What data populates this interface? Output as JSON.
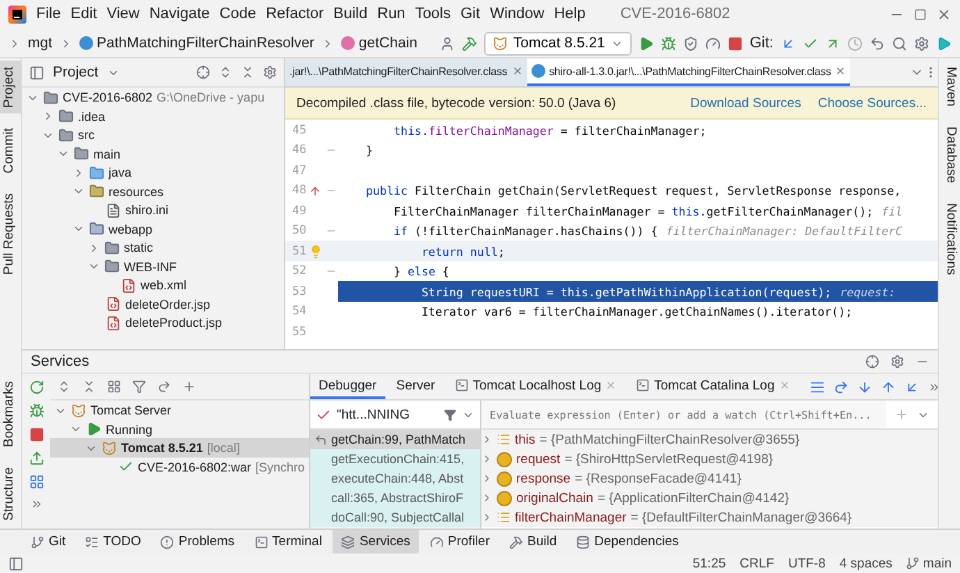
{
  "window": {
    "title": "CVE-2016-6802"
  },
  "menu": [
    "File",
    "Edit",
    "View",
    "Navigate",
    "Code",
    "Refactor",
    "Build",
    "Run",
    "Tools",
    "Git",
    "Window",
    "Help"
  ],
  "breadcrumbs": [
    {
      "label": "mgt",
      "kind": "package"
    },
    {
      "label": "PathMatchingFilterChainResolver",
      "kind": "class"
    },
    {
      "label": "getChain",
      "kind": "method"
    }
  ],
  "toolbar": {
    "run_config": "Tomcat 8.5.21",
    "git_label": "Git:"
  },
  "side_tabs": {
    "left_top": [
      {
        "label": "Project",
        "selected": true
      },
      {
        "label": "Commit",
        "selected": false
      },
      {
        "label": "Pull Requests",
        "selected": false
      }
    ],
    "left_bottom": [
      {
        "label": "Bookmarks",
        "selected": false
      },
      {
        "label": "Structure",
        "selected": false
      }
    ],
    "right": [
      {
        "label": "Maven",
        "selected": false
      },
      {
        "label": "Database",
        "selected": false
      },
      {
        "label": "Notifications",
        "selected": false
      }
    ]
  },
  "project": {
    "title": "Project",
    "tree": [
      {
        "label": "CVE-2016-6802",
        "note": "G:\\OneDrive - yapu",
        "kind": "module",
        "expanded": true,
        "children": [
          {
            "label": ".idea",
            "kind": "folder",
            "expanded": false
          },
          {
            "label": "src",
            "kind": "folder",
            "expanded": true,
            "children": [
              {
                "label": "main",
                "kind": "folder",
                "expanded": true,
                "children": [
                  {
                    "label": "java",
                    "kind": "source",
                    "expanded": false
                  },
                  {
                    "label": "resources",
                    "kind": "resources",
                    "expanded": true,
                    "children": [
                      {
                        "label": "shiro.ini",
                        "kind": "file"
                      }
                    ]
                  },
                  {
                    "label": "webapp",
                    "kind": "web",
                    "expanded": true,
                    "children": [
                      {
                        "label": "static",
                        "kind": "folder",
                        "expanded": false
                      },
                      {
                        "label": "WEB-INF",
                        "kind": "folder",
                        "expanded": true,
                        "children": [
                          {
                            "label": "web.xml",
                            "kind": "xml"
                          }
                        ]
                      },
                      {
                        "label": "deleteOrder.jsp",
                        "kind": "jsp"
                      },
                      {
                        "label": "deleteProduct.jsp",
                        "kind": "jsp"
                      }
                    ]
                  }
                ]
              }
            ]
          }
        ]
      }
    ]
  },
  "editor": {
    "tabs": [
      {
        "label": ".jar!\\...\\PathMatchingFilterChainResolver.class",
        "selected": false
      },
      {
        "label": "shiro-all-1.3.0.jar!\\...\\PathMatchingFilterChainResolver.class",
        "selected": true
      }
    ],
    "banner": {
      "text": "Decompiled .class file, bytecode version: 50.0 (Java 6)",
      "links": [
        "Download Sources",
        "Choose Sources..."
      ]
    },
    "lines": [
      {
        "number": "45",
        "kind": "plain",
        "fold": false,
        "execution": false,
        "caret": false,
        "tokens": [
          {
            "text": "        this.",
            "kind": "keyword"
          },
          {
            "text": "filterChainManager",
            "kind": "field"
          },
          {
            "text": " = filterChainManager;",
            "kind": "plain"
          }
        ]
      },
      {
        "number": "46",
        "kind": "plain",
        "fold": true,
        "execution": false,
        "caret": false,
        "tokens": [
          {
            "text": "    }",
            "kind": "plain"
          }
        ]
      },
      {
        "number": "47",
        "kind": "plain",
        "fold": false,
        "execution": false,
        "caret": false
      },
      {
        "number": "48",
        "kind": "override",
        "fold": true,
        "execution": false,
        "caret": false,
        "tokens": [
          {
            "text": "    public",
            "kind": "keyword"
          },
          {
            "text": " FilterChain getChain(ServletRequest request, ServletResponse response,",
            "kind": "plain"
          }
        ]
      },
      {
        "number": "49",
        "kind": "plain",
        "fold": false,
        "execution": false,
        "caret": false,
        "tokens": [
          {
            "text": "        FilterChainManager filterChainManager = ",
            "kind": "plain"
          },
          {
            "text": "this",
            "kind": "keyword"
          },
          {
            "text": ".getFilterChainManager();",
            "kind": "plain"
          }
        ],
        "hint": "fil"
      },
      {
        "number": "50",
        "kind": "plain",
        "fold": true,
        "execution": false,
        "caret": false,
        "tokens": [
          {
            "text": "        if",
            "kind": "keyword"
          },
          {
            "text": " (!filterChainManager.hasChains()) {",
            "kind": "plain"
          }
        ],
        "hint": "filterChainManager: DefaultFilterC"
      },
      {
        "number": "51",
        "kind": "bulb",
        "fold": false,
        "execution": false,
        "caret": true,
        "tokens": [
          {
            "text": "            return null",
            "kind": "keyword"
          },
          {
            "text": ";",
            "kind": "plain"
          }
        ]
      },
      {
        "number": "52",
        "kind": "plain",
        "fold": true,
        "execution": false,
        "caret": false,
        "tokens": [
          {
            "text": "        } ",
            "kind": "plain"
          },
          {
            "text": "else",
            "kind": "keyword"
          },
          {
            "text": " {",
            "kind": "plain"
          }
        ]
      },
      {
        "number": "53",
        "kind": "plain",
        "fold": false,
        "execution": true,
        "caret": false,
        "tokens": [
          {
            "text": "            String requestURI = ",
            "kind": "plain"
          },
          {
            "text": "this",
            "kind": "keyword"
          },
          {
            "text": ".getPathWithinApplication(request);",
            "kind": "plain"
          }
        ],
        "hint": "request:"
      },
      {
        "number": "54",
        "kind": "plain",
        "fold": false,
        "execution": false,
        "caret": false,
        "tokens": [
          {
            "text": "            Iterator var6 = filterChainManager.getChainNames().iterator();",
            "kind": "plain"
          }
        ]
      },
      {
        "number": "55",
        "kind": "plain",
        "fold": false,
        "execution": false,
        "caret": false
      }
    ]
  },
  "services": {
    "title": "Services",
    "tree": [
      {
        "label": "Tomcat Server",
        "kind": "server",
        "expanded": true,
        "selected": false,
        "children": [
          {
            "label": "Running",
            "kind": "running",
            "expanded": true,
            "selected": false,
            "children": [
              {
                "label": "Tomcat 8.5.21",
                "note": "[local]",
                "kind": "instance",
                "expanded": true,
                "selected": true,
                "children": [
                  {
                    "label": "CVE-2016-6802:war",
                    "note": "[Synchro",
                    "kind": "artifact",
                    "selected": false
                  }
                ]
              }
            ]
          }
        ]
      }
    ],
    "debugger": {
      "tabs": [
        {
          "label": "Debugger",
          "kind": "plain",
          "selected": true
        },
        {
          "label": "Server",
          "kind": "plain",
          "selected": false
        },
        {
          "label": "Tomcat Localhost Log",
          "kind": "log",
          "selected": false
        },
        {
          "label": "Tomcat Catalina Log",
          "kind": "log",
          "selected": false
        }
      ],
      "thread": "\"htt...NNING",
      "frames": [
        {
          "label": "getChain:99, PathMatch",
          "selected": true
        },
        {
          "label": "getExecutionChain:415,",
          "selected": false
        },
        {
          "label": "executeChain:448, Abst",
          "selected": false
        },
        {
          "label": "call:365, AbstractShiroF",
          "selected": false
        },
        {
          "label": "doCall:90, SubjectCallal",
          "selected": false
        }
      ],
      "watch_placeholder": "Evaluate expression (Enter) or add a watch (Ctrl+Shift+En...",
      "variables": [
        {
          "name": "this",
          "value": "= {PathMatchingFilterChainResolver@3655}",
          "kind": "field"
        },
        {
          "name": "request",
          "value": "= {ShiroHttpServletRequest@4198}",
          "kind": "param"
        },
        {
          "name": "response",
          "value": "= {ResponseFacade@4141}",
          "kind": "param"
        },
        {
          "name": "originalChain",
          "value": "= {ApplicationFilterChain@4142}",
          "kind": "param"
        },
        {
          "name": "filterChainManager",
          "value": "= {DefaultFilterChainManager@3664}",
          "kind": "field"
        }
      ]
    }
  },
  "tool_windows": [
    {
      "label": "Git",
      "kind": "git",
      "selected": false
    },
    {
      "label": "TODO",
      "kind": "todo",
      "selected": false
    },
    {
      "label": "Problems",
      "kind": "problems",
      "selected": false
    },
    {
      "label": "Terminal",
      "kind": "terminal",
      "selected": false
    },
    {
      "label": "Services",
      "kind": "services",
      "selected": true
    },
    {
      "label": "Profiler",
      "kind": "profiler",
      "selected": false
    },
    {
      "label": "Build",
      "kind": "build",
      "selected": false
    },
    {
      "label": "Dependencies",
      "kind": "dependencies",
      "selected": false
    }
  ],
  "status_bar": {
    "items": [
      "51:25",
      "CRLF",
      "UTF-8",
      "4 spaces"
    ],
    "branch": "main"
  }
}
